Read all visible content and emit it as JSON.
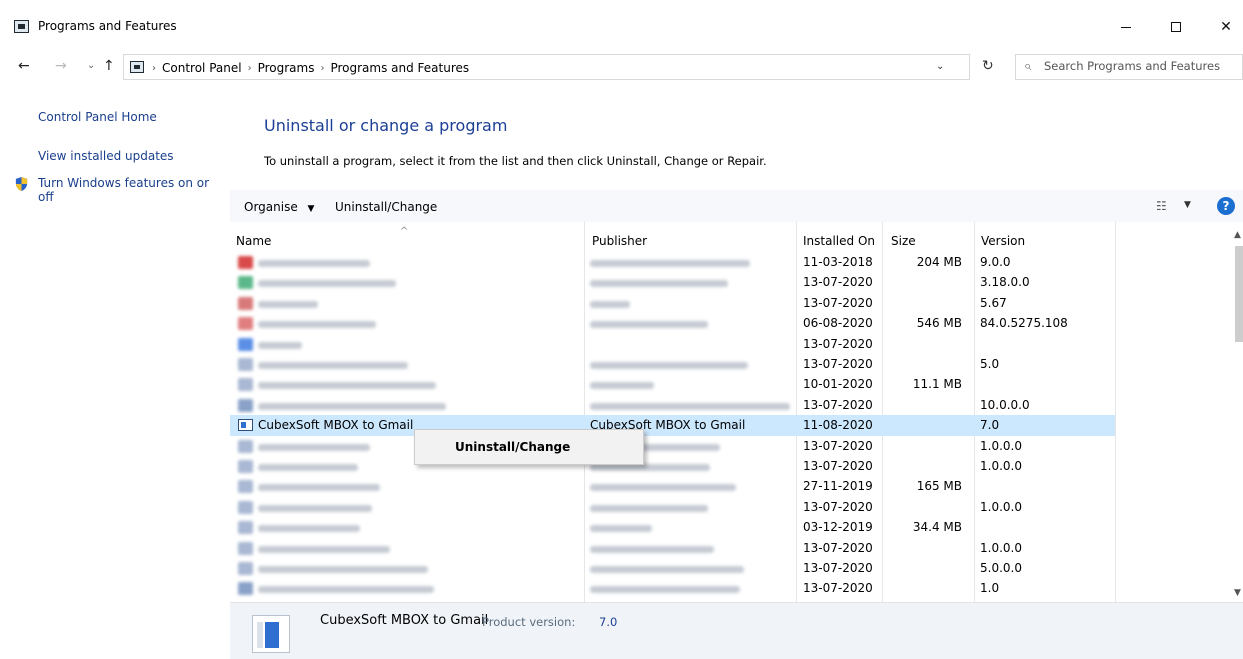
{
  "window": {
    "title": "Programs and Features",
    "minimize_label": "—",
    "maximize_label": "☐",
    "close_label": "✕"
  },
  "address": {
    "crumbs": [
      "Control Panel",
      "Programs",
      "Programs and Features"
    ],
    "search_placeholder": "Search Programs and Features"
  },
  "sidebar": {
    "items": [
      {
        "label": "Control Panel Home"
      },
      {
        "label": "View installed updates"
      },
      {
        "label": "Turn Windows features on or off"
      }
    ]
  },
  "main": {
    "title": "Uninstall or change a program",
    "subtitle": "To uninstall a program, select it from the list and then click Uninstall, Change or Repair."
  },
  "toolbar": {
    "organise_label": "Organise",
    "uninstall_label": "Uninstall/Change"
  },
  "list": {
    "columns": [
      "Name",
      "Publisher",
      "Installed On",
      "Size",
      "Version"
    ],
    "rows": [
      {
        "name": "",
        "publisher": "",
        "installed": "11-03-2018",
        "size": "204 MB",
        "version": "9.0.0"
      },
      {
        "name": "",
        "publisher": "",
        "installed": "13-07-2020",
        "size": "",
        "version": "3.18.0.0"
      },
      {
        "name": "",
        "publisher": "",
        "installed": "13-07-2020",
        "size": "",
        "version": "5.67"
      },
      {
        "name": "",
        "publisher": "",
        "installed": "06-08-2020",
        "size": "546 MB",
        "version": "84.0.5275.108"
      },
      {
        "name": "",
        "publisher": "",
        "installed": "13-07-2020",
        "size": "",
        "version": ""
      },
      {
        "name": "",
        "publisher": "",
        "installed": "13-07-2020",
        "size": "",
        "version": "5.0"
      },
      {
        "name": "",
        "publisher": "",
        "installed": "10-01-2020",
        "size": "11.1 MB",
        "version": ""
      },
      {
        "name": "",
        "publisher": "",
        "installed": "13-07-2020",
        "size": "",
        "version": "10.0.0.0"
      },
      {
        "name": "CubexSoft MBOX to Gmail",
        "publisher": "CubexSoft MBOX to Gmail",
        "installed": "11-08-2020",
        "size": "",
        "version": "7.0"
      },
      {
        "name": "",
        "publisher": "",
        "installed": "13-07-2020",
        "size": "",
        "version": "1.0.0.0"
      },
      {
        "name": "",
        "publisher": "",
        "installed": "13-07-2020",
        "size": "",
        "version": "1.0.0.0"
      },
      {
        "name": "",
        "publisher": "",
        "installed": "27-11-2019",
        "size": "165 MB",
        "version": ""
      },
      {
        "name": "",
        "publisher": "",
        "installed": "13-07-2020",
        "size": "",
        "version": "1.0.0.0"
      },
      {
        "name": "",
        "publisher": "",
        "installed": "03-12-2019",
        "size": "34.4 MB",
        "version": ""
      },
      {
        "name": "",
        "publisher": "",
        "installed": "13-07-2020",
        "size": "",
        "version": "1.0.0.0"
      },
      {
        "name": "",
        "publisher": "",
        "installed": "13-07-2020",
        "size": "",
        "version": "5.0.0.0"
      },
      {
        "name": "",
        "publisher": "",
        "installed": "13-07-2020",
        "size": "",
        "version": "1.0"
      }
    ]
  },
  "context_menu": {
    "item_label": "Uninstall/Change"
  },
  "details": {
    "name": "CubexSoft MBOX to Gmail",
    "version_label": "Product version:",
    "version_value": "7.0"
  },
  "colors": {
    "link": "#1a3f8c",
    "title": "#1c3f95",
    "selected_row": "#cce8ff",
    "toolbar_bg": "#f6f8fb"
  }
}
